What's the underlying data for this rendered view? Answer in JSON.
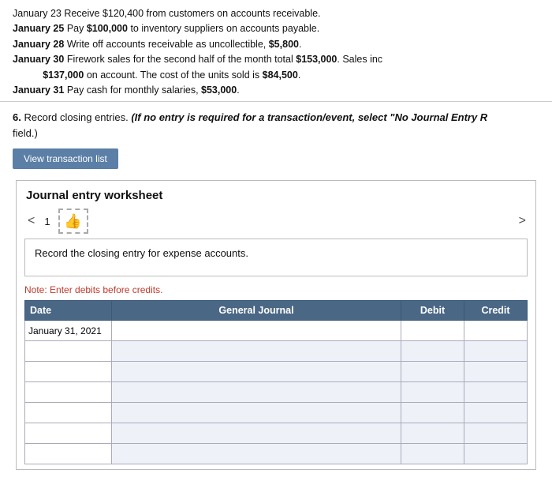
{
  "transactions": [
    {
      "id": "jan23",
      "text": "January 23 Receive $120,400 from customers on accounts receivable."
    },
    {
      "id": "jan25",
      "text": "January 25 Pay $100,000 to inventory suppliers on accounts payable."
    },
    {
      "id": "jan28",
      "text": "January 28 Write off accounts receivable as uncollectible, $5,800."
    },
    {
      "id": "jan30",
      "text": "January 30 Firework sales for the second half of the month total $153,000. Sales inc"
    },
    {
      "id": "jan30b",
      "text": "           $137,000 on account. The cost of the units sold is $84,500."
    },
    {
      "id": "jan31",
      "text": "January 31 Pay cash for monthly salaries, $53,000."
    }
  ],
  "question": {
    "number": "6.",
    "main_text": " Record closing entries. ",
    "italic_text": "(If no entry is required for a transaction/event, select \"No Journal Entry R",
    "continuation": "field.)"
  },
  "btn_label": "View transaction list",
  "worksheet": {
    "title": "Journal entry worksheet",
    "nav_number": "1",
    "nav_left": "<",
    "nav_right": ">",
    "instruction": "Record the closing entry for expense accounts.",
    "note": "Note: Enter debits before credits.",
    "table": {
      "headers": {
        "date": "Date",
        "general_journal": "General Journal",
        "debit": "Debit",
        "credit": "Credit"
      },
      "rows": [
        {
          "date": "January 31, 2021",
          "gj": "",
          "debit": "",
          "credit": ""
        },
        {
          "date": "",
          "gj": "",
          "debit": "",
          "credit": ""
        },
        {
          "date": "",
          "gj": "",
          "debit": "",
          "credit": ""
        },
        {
          "date": "",
          "gj": "",
          "debit": "",
          "credit": ""
        },
        {
          "date": "",
          "gj": "",
          "debit": "",
          "credit": ""
        },
        {
          "date": "",
          "gj": "",
          "debit": "",
          "credit": ""
        },
        {
          "date": "",
          "gj": "",
          "debit": "",
          "credit": ""
        }
      ]
    }
  }
}
